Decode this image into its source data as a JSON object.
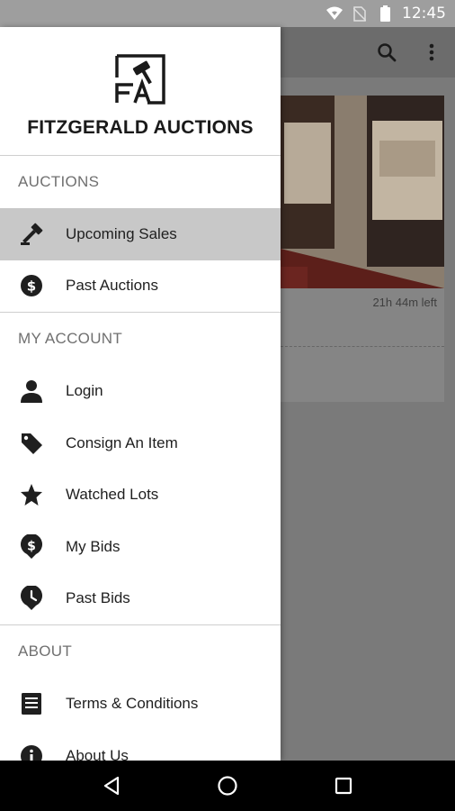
{
  "status_bar": {
    "time": "12:45"
  },
  "brand": {
    "logo_text": "FA",
    "name": "FITZGERALD AUCTIONS"
  },
  "background_app": {
    "time_left": "21h 44m left"
  },
  "drawer": {
    "sections": [
      {
        "header": "AUCTIONS",
        "items": [
          {
            "label": "Upcoming Sales",
            "icon": "gavel-icon",
            "active": true
          },
          {
            "label": "Past Auctions",
            "icon": "dollar-circle-icon",
            "active": false
          }
        ]
      },
      {
        "header": "MY ACCOUNT",
        "items": [
          {
            "label": "Login",
            "icon": "person-icon",
            "active": false
          },
          {
            "label": "Consign An Item",
            "icon": "tag-icon",
            "active": false
          },
          {
            "label": "Watched Lots",
            "icon": "star-icon",
            "active": false
          },
          {
            "label": "My Bids",
            "icon": "dollar-pin-icon",
            "active": false
          },
          {
            "label": "Past Bids",
            "icon": "clock-pin-icon",
            "active": false
          }
        ]
      },
      {
        "header": "ABOUT",
        "items": [
          {
            "label": "Terms & Conditions",
            "icon": "document-icon",
            "active": false
          },
          {
            "label": "About Us",
            "icon": "info-icon",
            "active": false
          }
        ]
      }
    ]
  },
  "colors": {
    "drawer_bg": "#ffffff",
    "active_item_bg": "#c8c8c8",
    "scrim": "#7a7a7a",
    "text": "#1f1f1f",
    "section_header": "#707070"
  }
}
